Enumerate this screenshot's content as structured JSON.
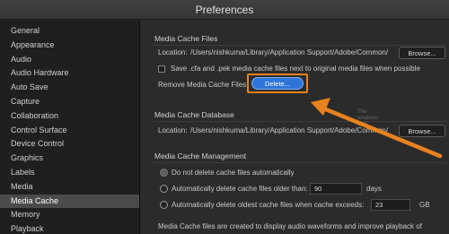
{
  "window": {
    "title": "Preferences"
  },
  "sidebar": {
    "items": [
      {
        "label": "General"
      },
      {
        "label": "Appearance"
      },
      {
        "label": "Audio"
      },
      {
        "label": "Audio Hardware"
      },
      {
        "label": "Auto Save"
      },
      {
        "label": "Capture"
      },
      {
        "label": "Collaboration"
      },
      {
        "label": "Control Surface"
      },
      {
        "label": "Device Control"
      },
      {
        "label": "Graphics"
      },
      {
        "label": "Labels"
      },
      {
        "label": "Media"
      },
      {
        "label": "Media Cache"
      },
      {
        "label": "Memory"
      },
      {
        "label": "Playback"
      }
    ],
    "selected": "Media Cache"
  },
  "media_cache_files": {
    "title": "Media Cache Files",
    "location_label": "Location:",
    "location_path": "/Users/nishkuma/Library/Application Support/Adobe/Common/",
    "browse_label": "Browse...",
    "save_checkbox_label": "Save .cfa and .pek media cache files next to original media files when possible",
    "remove_label": "Remove Media Cache Files",
    "delete_label": "Delete..."
  },
  "media_cache_database": {
    "title": "Media Cache Database",
    "location_label": "Location:",
    "location_path": "/Users/nishkuma/Library/Application Support/Adobe/Common/",
    "browse_label": "Browse..."
  },
  "media_cache_management": {
    "title": "Media Cache Management",
    "option1": "Do not delete cache files automatically",
    "option2": "Automatically delete cache files older than:",
    "days_value": "90",
    "days_unit": "days",
    "option3": "Automatically delete oldest cache files when cache exceeds:",
    "size_value": "23",
    "size_unit": "GB",
    "description": "Media Cache files are created to display audio waveforms and improve playback of"
  },
  "colors": {
    "highlight": "#e8821f",
    "primary_button": "#2e74d8"
  }
}
